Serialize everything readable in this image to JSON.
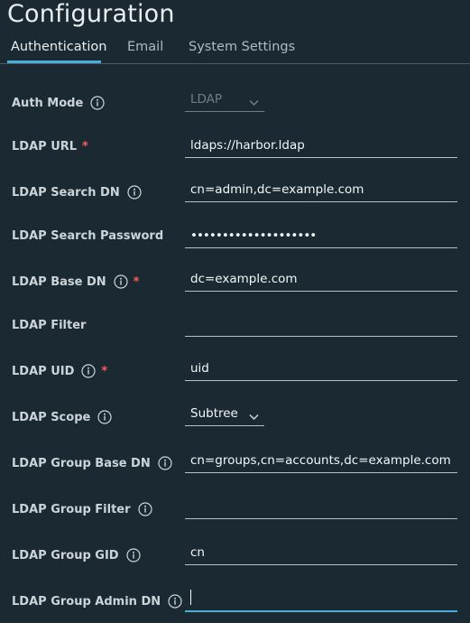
{
  "page": {
    "title": "Configuration"
  },
  "tabs": [
    {
      "label": "Authentication",
      "active": true
    },
    {
      "label": "Email",
      "active": false
    },
    {
      "label": "System Settings",
      "active": false
    }
  ],
  "form": {
    "auth_mode": {
      "label": "Auth Mode",
      "value": "LDAP",
      "disabled": true
    },
    "ldap_url": {
      "label": "LDAP URL",
      "value": "ldaps://harbor.ldap",
      "required": true
    },
    "ldap_search_dn": {
      "label": "LDAP Search DN",
      "value": "cn=admin,dc=example.com"
    },
    "ldap_search_password": {
      "label": "LDAP Search Password",
      "value": "••••••••••••••••••••"
    },
    "ldap_base_dn": {
      "label": "LDAP Base DN",
      "value": "dc=example.com",
      "required": true
    },
    "ldap_filter": {
      "label": "LDAP Filter",
      "value": ""
    },
    "ldap_uid": {
      "label": "LDAP UID",
      "value": "uid",
      "required": true
    },
    "ldap_scope": {
      "label": "LDAP Scope",
      "value": "Subtree"
    },
    "ldap_group_base_dn": {
      "label": "LDAP Group Base DN",
      "value": "cn=groups,cn=accounts,dc=example.com"
    },
    "ldap_group_filter": {
      "label": "LDAP Group Filter",
      "value": ""
    },
    "ldap_group_gid": {
      "label": "LDAP Group GID",
      "value": "cn"
    },
    "ldap_group_admin_dn": {
      "label": "LDAP Group Admin DN",
      "value": ""
    }
  },
  "required_marker": "*",
  "icons": {
    "info": "info-circle-icon",
    "chevron": "chevron-down-icon"
  },
  "colors": {
    "background": "#1b2a32",
    "accent": "#49afd9",
    "required": "#ff5a5a"
  }
}
